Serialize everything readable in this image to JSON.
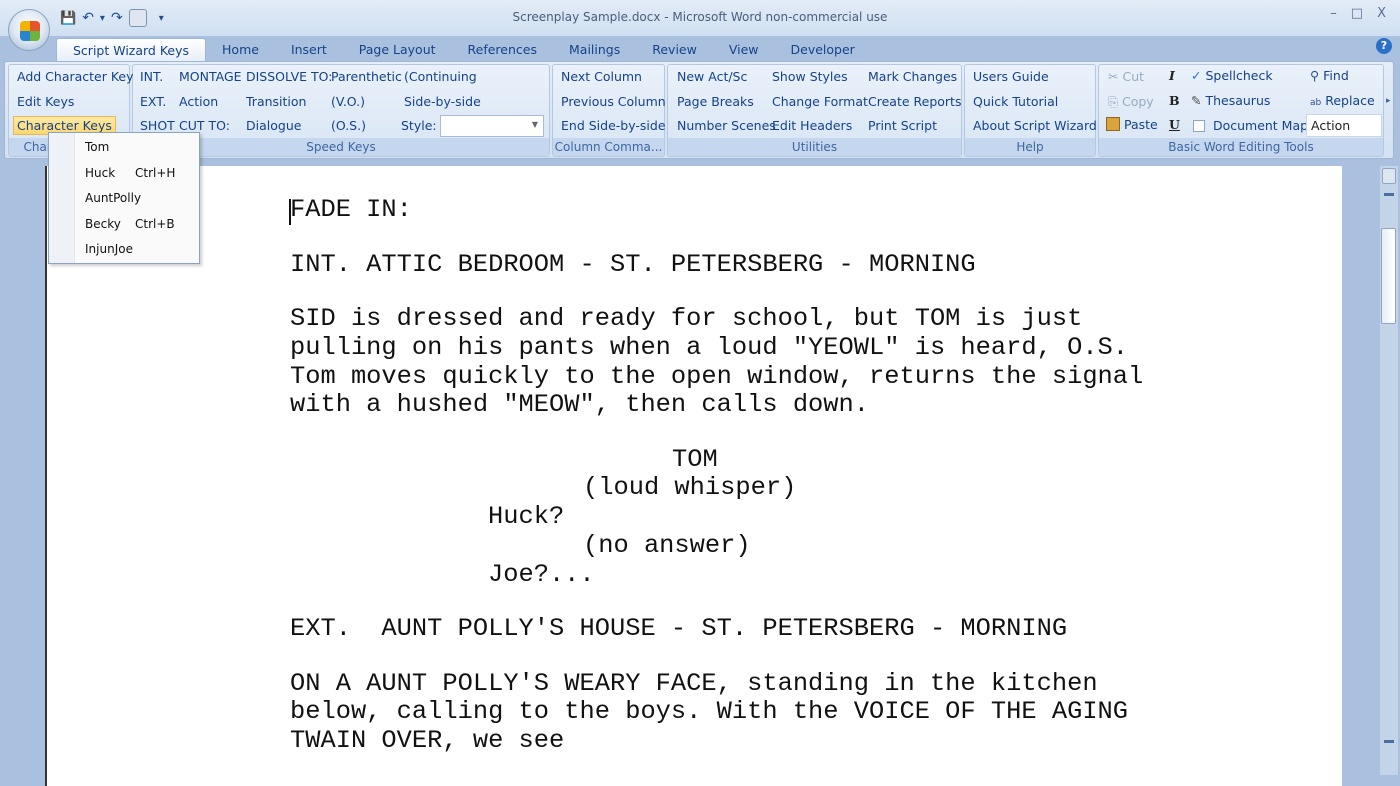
{
  "window": {
    "title": "Screenplay Sample.docx - Microsoft Word non-commercial use",
    "minimize": "–",
    "maximize": "□",
    "close": "X"
  },
  "qat": {
    "save": "💾",
    "undo": "↶",
    "dropdown": "▾",
    "redo": "↷",
    "customize": "▾"
  },
  "tabs": [
    "Script Wizard Keys",
    "Home",
    "Insert",
    "Page Layout",
    "References",
    "Mailings",
    "Review",
    "View",
    "Developer"
  ],
  "help": "?",
  "groups": {
    "character": {
      "label": "Character Keys",
      "items": [
        "Add Character Key",
        "Edit Keys",
        "Character Keys"
      ]
    },
    "speed": {
      "label": "Speed Keys",
      "col1": [
        "INT.",
        "EXT.",
        "SHOT"
      ],
      "col2": [
        "MONTAGE",
        "Action",
        "CUT TO:"
      ],
      "col3": [
        "DISSOLVE TO:",
        "Transition",
        "Dialogue"
      ],
      "col4": [
        "Parenthetic",
        "(V.O.)",
        "(O.S.)"
      ],
      "col5": [
        "(Continuing",
        "Side-by-side",
        "Style:"
      ],
      "style_value": ""
    },
    "column": {
      "label": "Column Comma...",
      "items": [
        "Next Column",
        "Previous Column",
        "End Side-by-side"
      ]
    },
    "utilities": {
      "label": "Utilities",
      "col1": [
        "New Act/Sc",
        "Page Breaks",
        "Number Scenes"
      ],
      "col2": [
        "Show Styles",
        "Change Format",
        "Edit Headers"
      ],
      "col3": [
        "Mark Changes",
        "Create Reports",
        "Print Script"
      ]
    },
    "help": {
      "label": "Help",
      "items": [
        "Users Guide",
        "Quick Tutorial",
        "About Script Wizard"
      ]
    },
    "basic": {
      "label": "Basic Word Editing Tools",
      "cut": "Cut",
      "copy": "Copy",
      "paste": "Paste",
      "italic": "I",
      "bold": "B",
      "underline": "U",
      "spellcheck": "Spellcheck",
      "thesaurus": "Thesaurus",
      "document_map": "Document Map",
      "document_map_checked": false,
      "find": "Find",
      "replace": "Replace",
      "style_value": "Action"
    }
  },
  "menu": [
    {
      "name": "Tom",
      "shortcut": ""
    },
    {
      "name": "Huck",
      "shortcut": "Ctrl+H"
    },
    {
      "name": "AuntPolly",
      "shortcut": ""
    },
    {
      "name": "Becky",
      "shortcut": "Ctrl+B"
    },
    {
      "name": "InjunJoe",
      "shortcut": ""
    }
  ],
  "document": {
    "blocks": [
      {
        "type": "action",
        "lines": [
          "FADE IN:"
        ]
      },
      {
        "type": "scene",
        "lines": [
          "INT. ATTIC BEDROOM - ST. PETERSBERG - MORNING"
        ]
      },
      {
        "type": "action",
        "lines": [
          "SID is dressed and ready for school, but TOM is just",
          "pulling on his pants when a loud \"YEOWL\" is heard, O.S.",
          "Tom moves quickly to the open window, returns the signal",
          "with a hushed \"MEOW\", then calls down."
        ]
      },
      {
        "type": "dialogue-block",
        "lines": [
          {
            "t": "character",
            "s": "TOM"
          },
          {
            "t": "paren",
            "s": "(loud whisper)"
          },
          {
            "t": "dialogue",
            "s": "Huck?"
          },
          {
            "t": "paren",
            "s": "(no answer)"
          },
          {
            "t": "dialogue",
            "s": "Joe?..."
          }
        ]
      },
      {
        "type": "scene",
        "lines": [
          "EXT.  AUNT POLLY'S HOUSE - ST. PETERSBERG - MORNING"
        ]
      },
      {
        "type": "action",
        "lines": [
          "ON A AUNT POLLY'S WEARY FACE, standing in the kitchen",
          "below, calling to the boys. With the VOICE OF THE AGING",
          "TWAIN OVER, we see"
        ]
      }
    ]
  }
}
